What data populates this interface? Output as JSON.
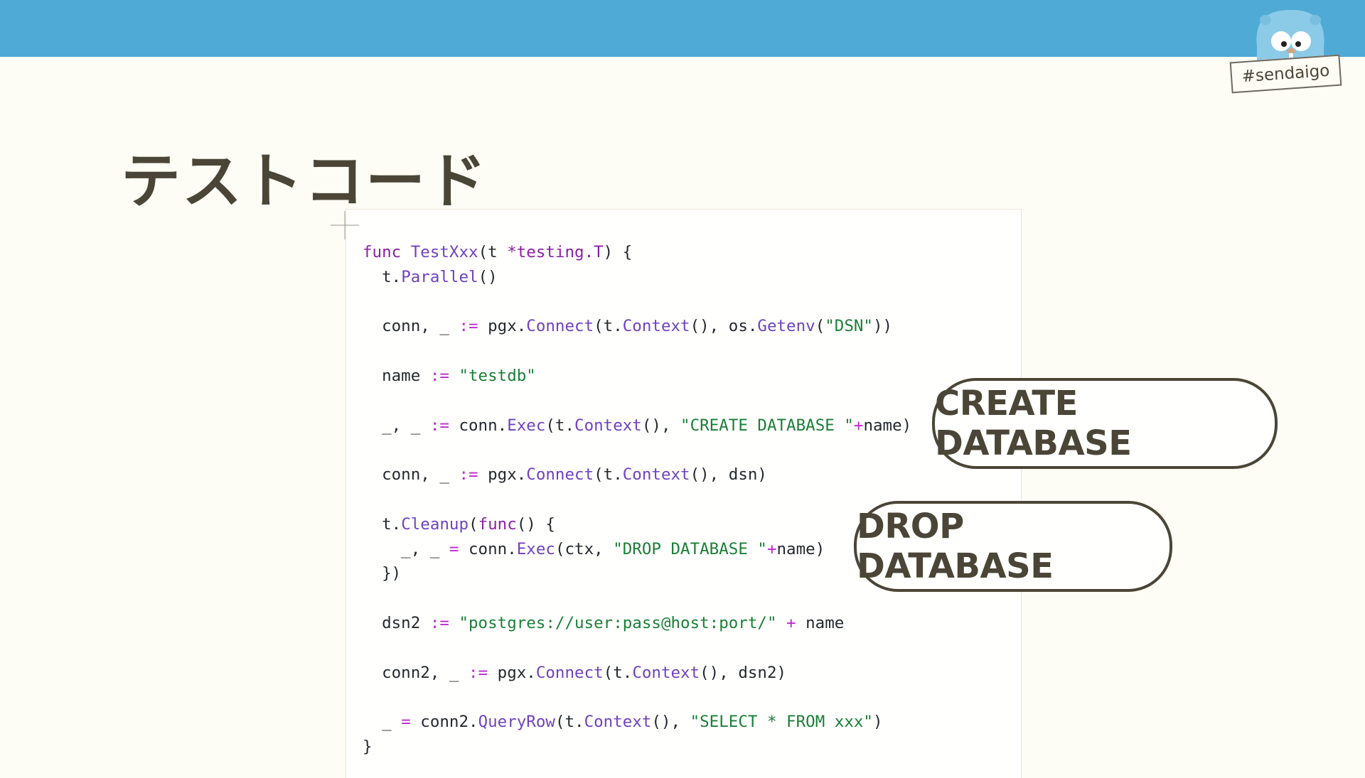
{
  "slide": {
    "title": "テストコード",
    "hashtag": "#sendaigo"
  },
  "code_lines": [
    [
      {
        "t": "func",
        "c": "kw"
      },
      {
        "t": " "
      },
      {
        "t": "TestXxx",
        "c": "fn"
      },
      {
        "t": "(t "
      },
      {
        "t": "*testing.T",
        "c": "kw"
      },
      {
        "t": ") {"
      }
    ],
    [
      {
        "t": "  t."
      },
      {
        "t": "Parallel",
        "c": "fn"
      },
      {
        "t": "()"
      }
    ],
    [],
    [
      {
        "t": "  conn, _ "
      },
      {
        "t": ":=",
        "c": "op"
      },
      {
        "t": " pgx."
      },
      {
        "t": "Connect",
        "c": "fn"
      },
      {
        "t": "(t."
      },
      {
        "t": "Context",
        "c": "fn"
      },
      {
        "t": "(), os."
      },
      {
        "t": "Getenv",
        "c": "fn"
      },
      {
        "t": "("
      },
      {
        "t": "\"DSN\"",
        "c": "str"
      },
      {
        "t": "))"
      }
    ],
    [],
    [
      {
        "t": "  name "
      },
      {
        "t": ":=",
        "c": "op"
      },
      {
        "t": " "
      },
      {
        "t": "\"testdb\"",
        "c": "str"
      }
    ],
    [],
    [
      {
        "t": "  _, _ "
      },
      {
        "t": ":=",
        "c": "op"
      },
      {
        "t": " conn."
      },
      {
        "t": "Exec",
        "c": "fn"
      },
      {
        "t": "(t."
      },
      {
        "t": "Context",
        "c": "fn"
      },
      {
        "t": "(), "
      },
      {
        "t": "\"CREATE DATABASE \"",
        "c": "str"
      },
      {
        "t": "+",
        "c": "op"
      },
      {
        "t": "name)"
      }
    ],
    [],
    [
      {
        "t": "  conn, _ "
      },
      {
        "t": ":=",
        "c": "op"
      },
      {
        "t": " pgx."
      },
      {
        "t": "Connect",
        "c": "fn"
      },
      {
        "t": "(t."
      },
      {
        "t": "Context",
        "c": "fn"
      },
      {
        "t": "(), dsn)"
      }
    ],
    [],
    [
      {
        "t": "  t."
      },
      {
        "t": "Cleanup",
        "c": "fn"
      },
      {
        "t": "("
      },
      {
        "t": "func",
        "c": "kw"
      },
      {
        "t": "() {"
      }
    ],
    [
      {
        "t": "    _, _ "
      },
      {
        "t": "=",
        "c": "op"
      },
      {
        "t": " conn."
      },
      {
        "t": "Exec",
        "c": "fn"
      },
      {
        "t": "(ctx, "
      },
      {
        "t": "\"DROP DATABASE \"",
        "c": "str"
      },
      {
        "t": "+",
        "c": "op"
      },
      {
        "t": "name)"
      }
    ],
    [
      {
        "t": "  })"
      }
    ],
    [],
    [
      {
        "t": "  dsn2 "
      },
      {
        "t": ":=",
        "c": "op"
      },
      {
        "t": " "
      },
      {
        "t": "\"postgres://user:pass@host:port/\"",
        "c": "str"
      },
      {
        "t": " "
      },
      {
        "t": "+",
        "c": "op"
      },
      {
        "t": " name"
      }
    ],
    [],
    [
      {
        "t": "  conn2, _ "
      },
      {
        "t": ":=",
        "c": "op"
      },
      {
        "t": " pgx."
      },
      {
        "t": "Connect",
        "c": "fn"
      },
      {
        "t": "(t."
      },
      {
        "t": "Context",
        "c": "fn"
      },
      {
        "t": "(), dsn2)"
      }
    ],
    [],
    [
      {
        "t": "  _ "
      },
      {
        "t": "=",
        "c": "op"
      },
      {
        "t": " conn2."
      },
      {
        "t": "QueryRow",
        "c": "fn"
      },
      {
        "t": "(t."
      },
      {
        "t": "Context",
        "c": "fn"
      },
      {
        "t": "(), "
      },
      {
        "t": "\"SELECT * FROM xxx\"",
        "c": "str"
      },
      {
        "t": ")"
      }
    ],
    [
      {
        "t": "}"
      }
    ]
  ],
  "callouts": {
    "create": "CREATE DATABASE",
    "drop": "DROP DATABASE"
  }
}
